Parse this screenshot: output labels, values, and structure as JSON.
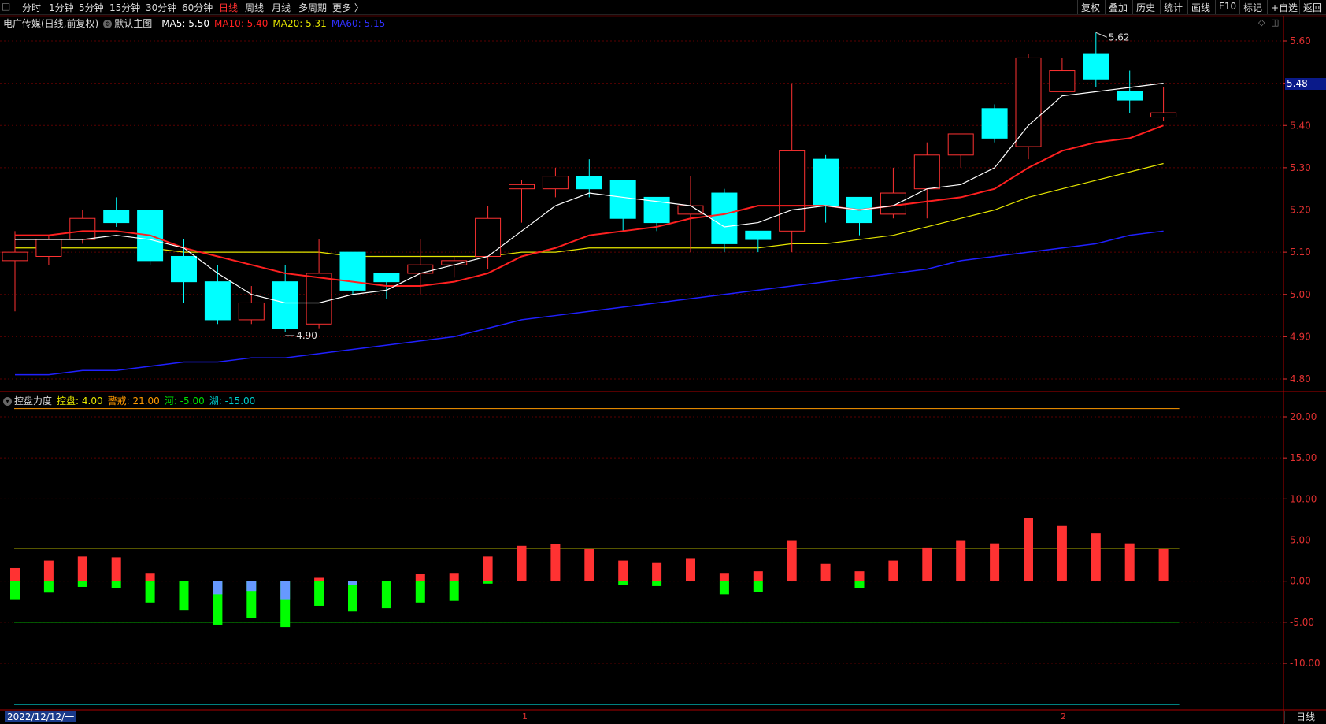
{
  "toolbar": {
    "left_icon": "◫",
    "periods": [
      "分时",
      "1分钟",
      "5分钟",
      "15分钟",
      "30分钟",
      "60分钟",
      "日线",
      "周线",
      "月线",
      "多周期",
      "更多 〉"
    ],
    "active_period": "日线",
    "right_buttons": [
      "复权",
      "叠加",
      "历史",
      "统计",
      "画线",
      "F10",
      "标记",
      "+自选",
      "返回"
    ]
  },
  "main_legend": {
    "title": "电广传媒(日线,前复权)",
    "indicator": "默认主图",
    "ma5": "MA5: 5.50",
    "ma10": "MA10: 5.40",
    "ma20": "MA20: 5.31",
    "ma60": "MA60: 5.15"
  },
  "sub_legend": {
    "title": "控盘力度",
    "kongpan": "控盘: 4.00",
    "jingjie": "警戒: 21.00",
    "he": "河: -5.00",
    "hu": "湖: -15.00"
  },
  "colors": {
    "up": "#ff3232",
    "down": "#00ffff",
    "ma5": "#ffffff",
    "ma10": "#ff2020",
    "ma20": "#e6e600",
    "ma60": "#2020ff",
    "axis": "#e03030",
    "grid": "#5a0000",
    "jingjie_line": "#ff9900",
    "kongpan_line": "#e6e600",
    "he_line": "#00e000",
    "hu_line": "#00cccc",
    "bar_green": "#00ff00",
    "bar_blue": "#6699ff"
  },
  "price_axis_labels": [
    "5.60",
    "5.50",
    "5.40",
    "5.30",
    "5.20",
    "5.10",
    "5.00",
    "4.90",
    "4.80"
  ],
  "current_price_tag": "5.48",
  "sub_axis_labels": [
    "20.00",
    "15.00",
    "10.00",
    "5.00",
    "0.00",
    "-5.00",
    "-10.00"
  ],
  "annotations": {
    "high": "5.62",
    "low": "4.90"
  },
  "bottom": {
    "date": "2022/12/12/一",
    "month_marks": [
      "1",
      "2"
    ],
    "period_label": "日线"
  },
  "chart_data": [
    {
      "type": "candlestick",
      "title": "电广传媒(日线,前复权)",
      "ylim": [
        4.78,
        5.64
      ],
      "candles": [
        {
          "o": 5.08,
          "h": 5.15,
          "l": 4.96,
          "c": 5.1
        },
        {
          "o": 5.09,
          "h": 5.14,
          "l": 5.07,
          "c": 5.13
        },
        {
          "o": 5.13,
          "h": 5.2,
          "l": 5.12,
          "c": 5.18
        },
        {
          "o": 5.2,
          "h": 5.23,
          "l": 5.16,
          "c": 5.17
        },
        {
          "o": 5.2,
          "h": 5.2,
          "l": 5.07,
          "c": 5.08
        },
        {
          "o": 5.09,
          "h": 5.13,
          "l": 4.98,
          "c": 5.03
        },
        {
          "o": 5.03,
          "h": 5.07,
          "l": 4.93,
          "c": 4.94
        },
        {
          "o": 4.94,
          "h": 5.02,
          "l": 4.93,
          "c": 4.98
        },
        {
          "o": 5.03,
          "h": 5.07,
          "l": 4.91,
          "c": 4.92
        },
        {
          "o": 4.93,
          "h": 5.13,
          "l": 4.92,
          "c": 5.05
        },
        {
          "o": 5.1,
          "h": 5.1,
          "l": 5.0,
          "c": 5.01
        },
        {
          "o": 5.05,
          "h": 5.05,
          "l": 4.99,
          "c": 5.03
        },
        {
          "o": 5.05,
          "h": 5.13,
          "l": 5.0,
          "c": 5.07
        },
        {
          "o": 5.07,
          "h": 5.09,
          "l": 5.04,
          "c": 5.08
        },
        {
          "o": 5.09,
          "h": 5.21,
          "l": 5.06,
          "c": 5.18
        },
        {
          "o": 5.25,
          "h": 5.27,
          "l": 5.17,
          "c": 5.26
        },
        {
          "o": 5.25,
          "h": 5.3,
          "l": 5.23,
          "c": 5.28
        },
        {
          "o": 5.28,
          "h": 5.32,
          "l": 5.23,
          "c": 5.25
        },
        {
          "o": 5.27,
          "h": 5.27,
          "l": 5.15,
          "c": 5.18
        },
        {
          "o": 5.23,
          "h": 5.23,
          "l": 5.15,
          "c": 5.17
        },
        {
          "o": 5.19,
          "h": 5.28,
          "l": 5.1,
          "c": 5.21
        },
        {
          "o": 5.24,
          "h": 5.25,
          "l": 5.1,
          "c": 5.12
        },
        {
          "o": 5.15,
          "h": 5.15,
          "l": 5.1,
          "c": 5.13
        },
        {
          "o": 5.15,
          "h": 5.5,
          "l": 5.1,
          "c": 5.34
        },
        {
          "o": 5.32,
          "h": 5.33,
          "l": 5.17,
          "c": 5.21
        },
        {
          "o": 5.23,
          "h": 5.23,
          "l": 5.14,
          "c": 5.17
        },
        {
          "o": 5.19,
          "h": 5.3,
          "l": 5.18,
          "c": 5.24
        },
        {
          "o": 5.25,
          "h": 5.36,
          "l": 5.18,
          "c": 5.33
        },
        {
          "o": 5.33,
          "h": 5.38,
          "l": 5.3,
          "c": 5.38
        },
        {
          "o": 5.44,
          "h": 5.45,
          "l": 5.36,
          "c": 5.37
        },
        {
          "o": 5.35,
          "h": 5.57,
          "l": 5.32,
          "c": 5.56
        },
        {
          "o": 5.48,
          "h": 5.56,
          "l": 5.48,
          "c": 5.53
        },
        {
          "o": 5.57,
          "h": 5.62,
          "l": 5.49,
          "c": 5.51
        },
        {
          "o": 5.48,
          "h": 5.53,
          "l": 5.43,
          "c": 5.46
        },
        {
          "o": 5.42,
          "h": 5.49,
          "l": 5.41,
          "c": 5.43
        }
      ],
      "ma5": [
        5.13,
        5.13,
        5.13,
        5.14,
        5.13,
        5.11,
        5.05,
        5.0,
        4.98,
        4.98,
        5.0,
        5.01,
        5.05,
        5.07,
        5.09,
        5.15,
        5.21,
        5.24,
        5.23,
        5.22,
        5.21,
        5.16,
        5.17,
        5.2,
        5.21,
        5.2,
        5.21,
        5.25,
        5.26,
        5.3,
        5.4,
        5.47,
        5.48,
        5.49,
        5.5
      ],
      "ma10": [
        5.14,
        5.14,
        5.15,
        5.15,
        5.14,
        5.11,
        5.09,
        5.07,
        5.05,
        5.04,
        5.03,
        5.02,
        5.02,
        5.03,
        5.05,
        5.09,
        5.11,
        5.14,
        5.15,
        5.16,
        5.18,
        5.19,
        5.21,
        5.21,
        5.21,
        5.2,
        5.21,
        5.22,
        5.23,
        5.25,
        5.3,
        5.34,
        5.36,
        5.37,
        5.4
      ],
      "ma20": [
        5.11,
        5.11,
        5.11,
        5.11,
        5.11,
        5.1,
        5.1,
        5.1,
        5.1,
        5.1,
        5.09,
        5.09,
        5.09,
        5.09,
        5.09,
        5.1,
        5.1,
        5.11,
        5.11,
        5.11,
        5.11,
        5.11,
        5.11,
        5.12,
        5.12,
        5.13,
        5.14,
        5.16,
        5.18,
        5.2,
        5.23,
        5.25,
        5.27,
        5.29,
        5.31
      ],
      "ma60": [
        4.81,
        4.81,
        4.82,
        4.82,
        4.83,
        4.84,
        4.84,
        4.85,
        4.85,
        4.86,
        4.87,
        4.88,
        4.89,
        4.9,
        4.92,
        4.94,
        4.95,
        4.96,
        4.97,
        4.98,
        4.99,
        5.0,
        5.01,
        5.02,
        5.03,
        5.04,
        5.05,
        5.06,
        5.08,
        5.09,
        5.1,
        5.11,
        5.12,
        5.14,
        5.15
      ]
    },
    {
      "type": "bar",
      "title": "控盘力度",
      "ylim": [
        -15,
        22
      ],
      "levels": {
        "jingjie": 21.0,
        "kongpan": 4.0,
        "he": -5.0,
        "hu": -15.0
      },
      "red": [
        1.6,
        2.5,
        3.0,
        2.9,
        1.0,
        0,
        0,
        0,
        0,
        0.4,
        0,
        0,
        0.9,
        1.0,
        3.0,
        4.3,
        4.5,
        3.9,
        2.5,
        2.2,
        2.8,
        1.0,
        1.2,
        4.9,
        2.1,
        1.2,
        2.5,
        4.1,
        4.9,
        4.6,
        7.7,
        6.7,
        5.8,
        4.6,
        3.9
      ],
      "green": [
        -2.2,
        -1.4,
        -0.7,
        -0.8,
        -2.6,
        -3.5,
        -5.3,
        -4.5,
        -5.6,
        -3.0,
        -3.7,
        -3.3,
        -2.6,
        -2.4,
        -0.3,
        0,
        0,
        0,
        -0.5,
        -0.6,
        0,
        -1.6,
        -1.3,
        0,
        0,
        -0.8,
        0,
        0,
        0,
        0,
        0,
        0,
        0,
        0,
        0
      ],
      "blue": [
        0,
        0,
        0,
        0,
        0,
        0,
        1.6,
        1.2,
        2.2,
        0,
        0.5,
        0,
        0,
        0,
        0,
        0,
        0,
        0,
        0,
        0,
        0,
        0,
        0,
        0,
        0,
        0,
        0,
        0,
        0,
        0,
        0,
        0,
        0,
        0,
        0
      ]
    }
  ]
}
